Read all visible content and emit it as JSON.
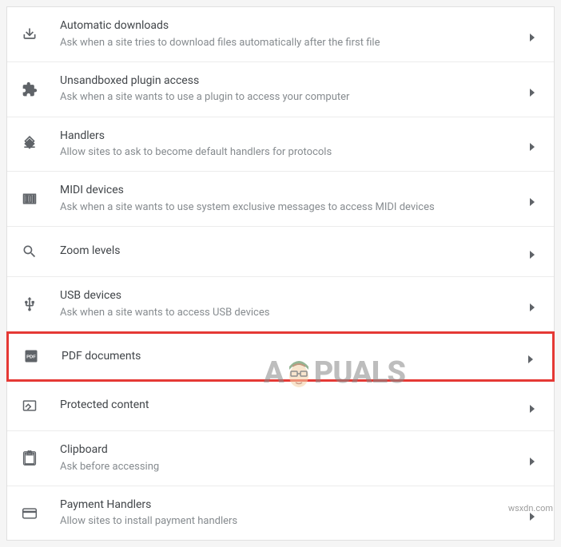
{
  "settings": [
    {
      "icon": "download",
      "title": "Automatic downloads",
      "description": "Ask when a site tries to download files automatically after the first file",
      "highlighted": false
    },
    {
      "icon": "puzzle",
      "title": "Unsandboxed plugin access",
      "description": "Ask when a site wants to use a plugin to access your computer",
      "highlighted": false
    },
    {
      "icon": "handlers",
      "title": "Handlers",
      "description": "Allow sites to ask to become default handlers for protocols",
      "highlighted": false
    },
    {
      "icon": "midi",
      "title": "MIDI devices",
      "description": "Ask when a site wants to use system exclusive messages to access MIDI devices",
      "highlighted": false
    },
    {
      "icon": "search",
      "title": "Zoom levels",
      "description": "",
      "highlighted": false
    },
    {
      "icon": "usb",
      "title": "USB devices",
      "description": "Ask when a site wants to access USB devices",
      "highlighted": false
    },
    {
      "icon": "pdf",
      "title": "PDF documents",
      "description": "",
      "highlighted": true
    },
    {
      "icon": "protected",
      "title": "Protected content",
      "description": "",
      "highlighted": false
    },
    {
      "icon": "clipboard",
      "title": "Clipboard",
      "description": "Ask before accessing",
      "highlighted": false
    },
    {
      "icon": "payment",
      "title": "Payment Handlers",
      "description": "Allow sites to install payment handlers",
      "highlighted": false
    }
  ],
  "watermark_text_left": "A",
  "watermark_text_right": "PUALS",
  "source_label": "wsxdn.com"
}
